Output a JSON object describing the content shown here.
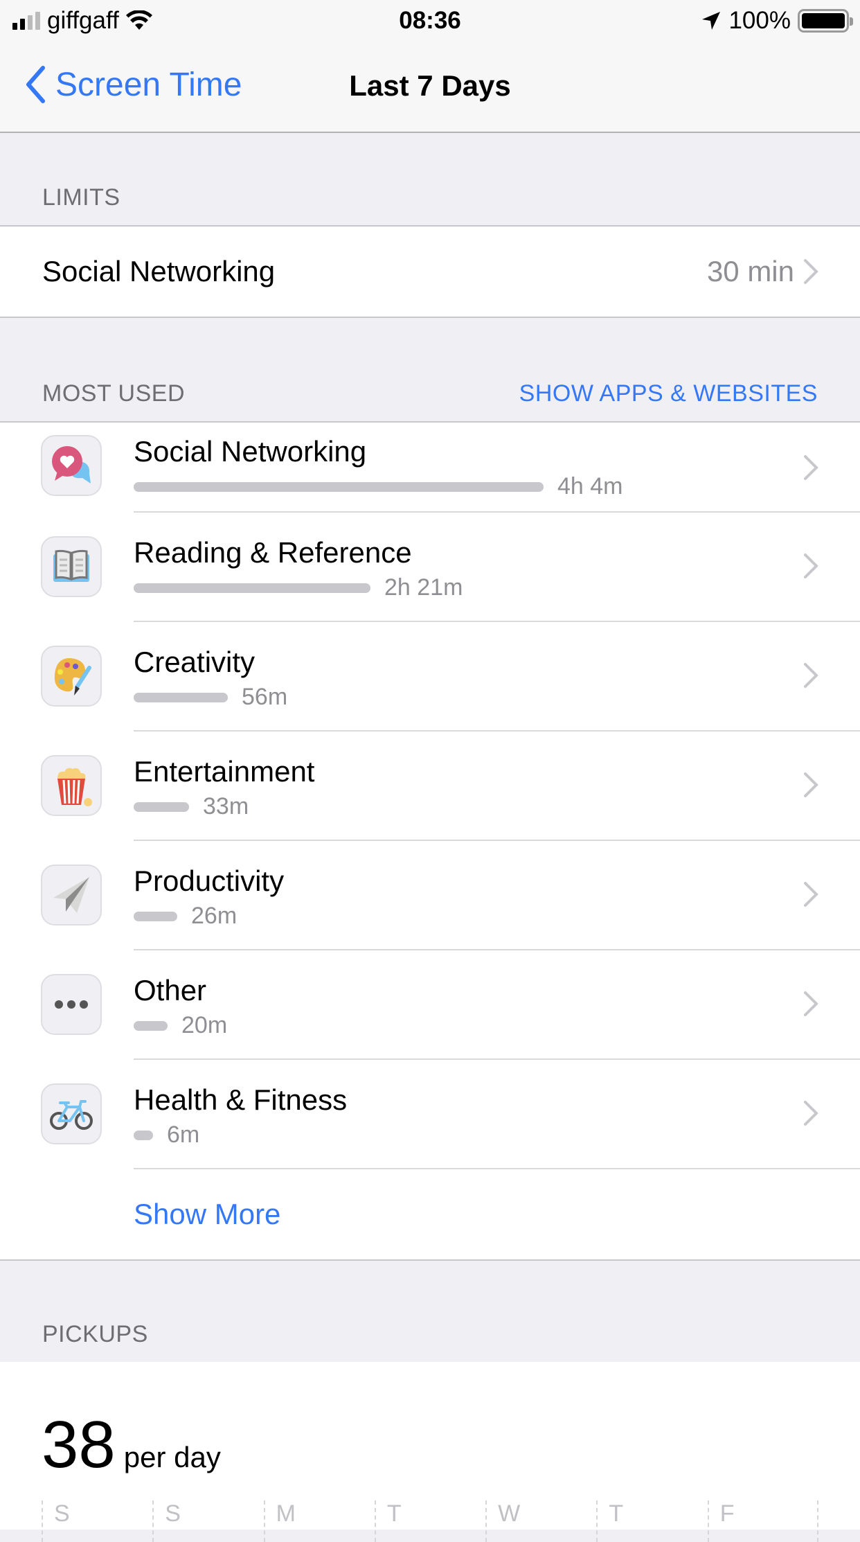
{
  "status_bar": {
    "carrier": "giffgaff",
    "time": "08:36",
    "battery": "100%"
  },
  "nav": {
    "back_label": "Screen Time",
    "title": "Last 7 Days"
  },
  "limits": {
    "header": "LIMITS",
    "items": [
      {
        "label": "Social Networking",
        "value": "30 min"
      }
    ]
  },
  "most_used": {
    "header": "MOST USED",
    "link": "SHOW APPS & WEBSITES",
    "max_minutes": 244,
    "items": [
      {
        "name": "Social Networking",
        "time": "4h 4m",
        "minutes": 244,
        "icon": "social-networking-icon"
      },
      {
        "name": "Reading & Reference",
        "time": "2h 21m",
        "minutes": 141,
        "icon": "reading-reference-icon"
      },
      {
        "name": "Creativity",
        "time": "56m",
        "minutes": 56,
        "icon": "creativity-icon"
      },
      {
        "name": "Entertainment",
        "time": "33m",
        "minutes": 33,
        "icon": "entertainment-icon"
      },
      {
        "name": "Productivity",
        "time": "26m",
        "minutes": 26,
        "icon": "productivity-icon"
      },
      {
        "name": "Other",
        "time": "20m",
        "minutes": 20,
        "icon": "other-icon"
      },
      {
        "name": "Health & Fitness",
        "time": "6m",
        "minutes": 6,
        "icon": "health-fitness-icon"
      }
    ],
    "show_more": "Show More"
  },
  "pickups": {
    "header": "PICKUPS",
    "value": "38",
    "unit": "per day",
    "days": [
      "S",
      "S",
      "M",
      "T",
      "W",
      "T",
      "F"
    ]
  },
  "colors": {
    "accent": "#3478f6",
    "bar": "#c7c7cc",
    "secondary_text": "#8e8e93",
    "background": "#efeff4"
  }
}
